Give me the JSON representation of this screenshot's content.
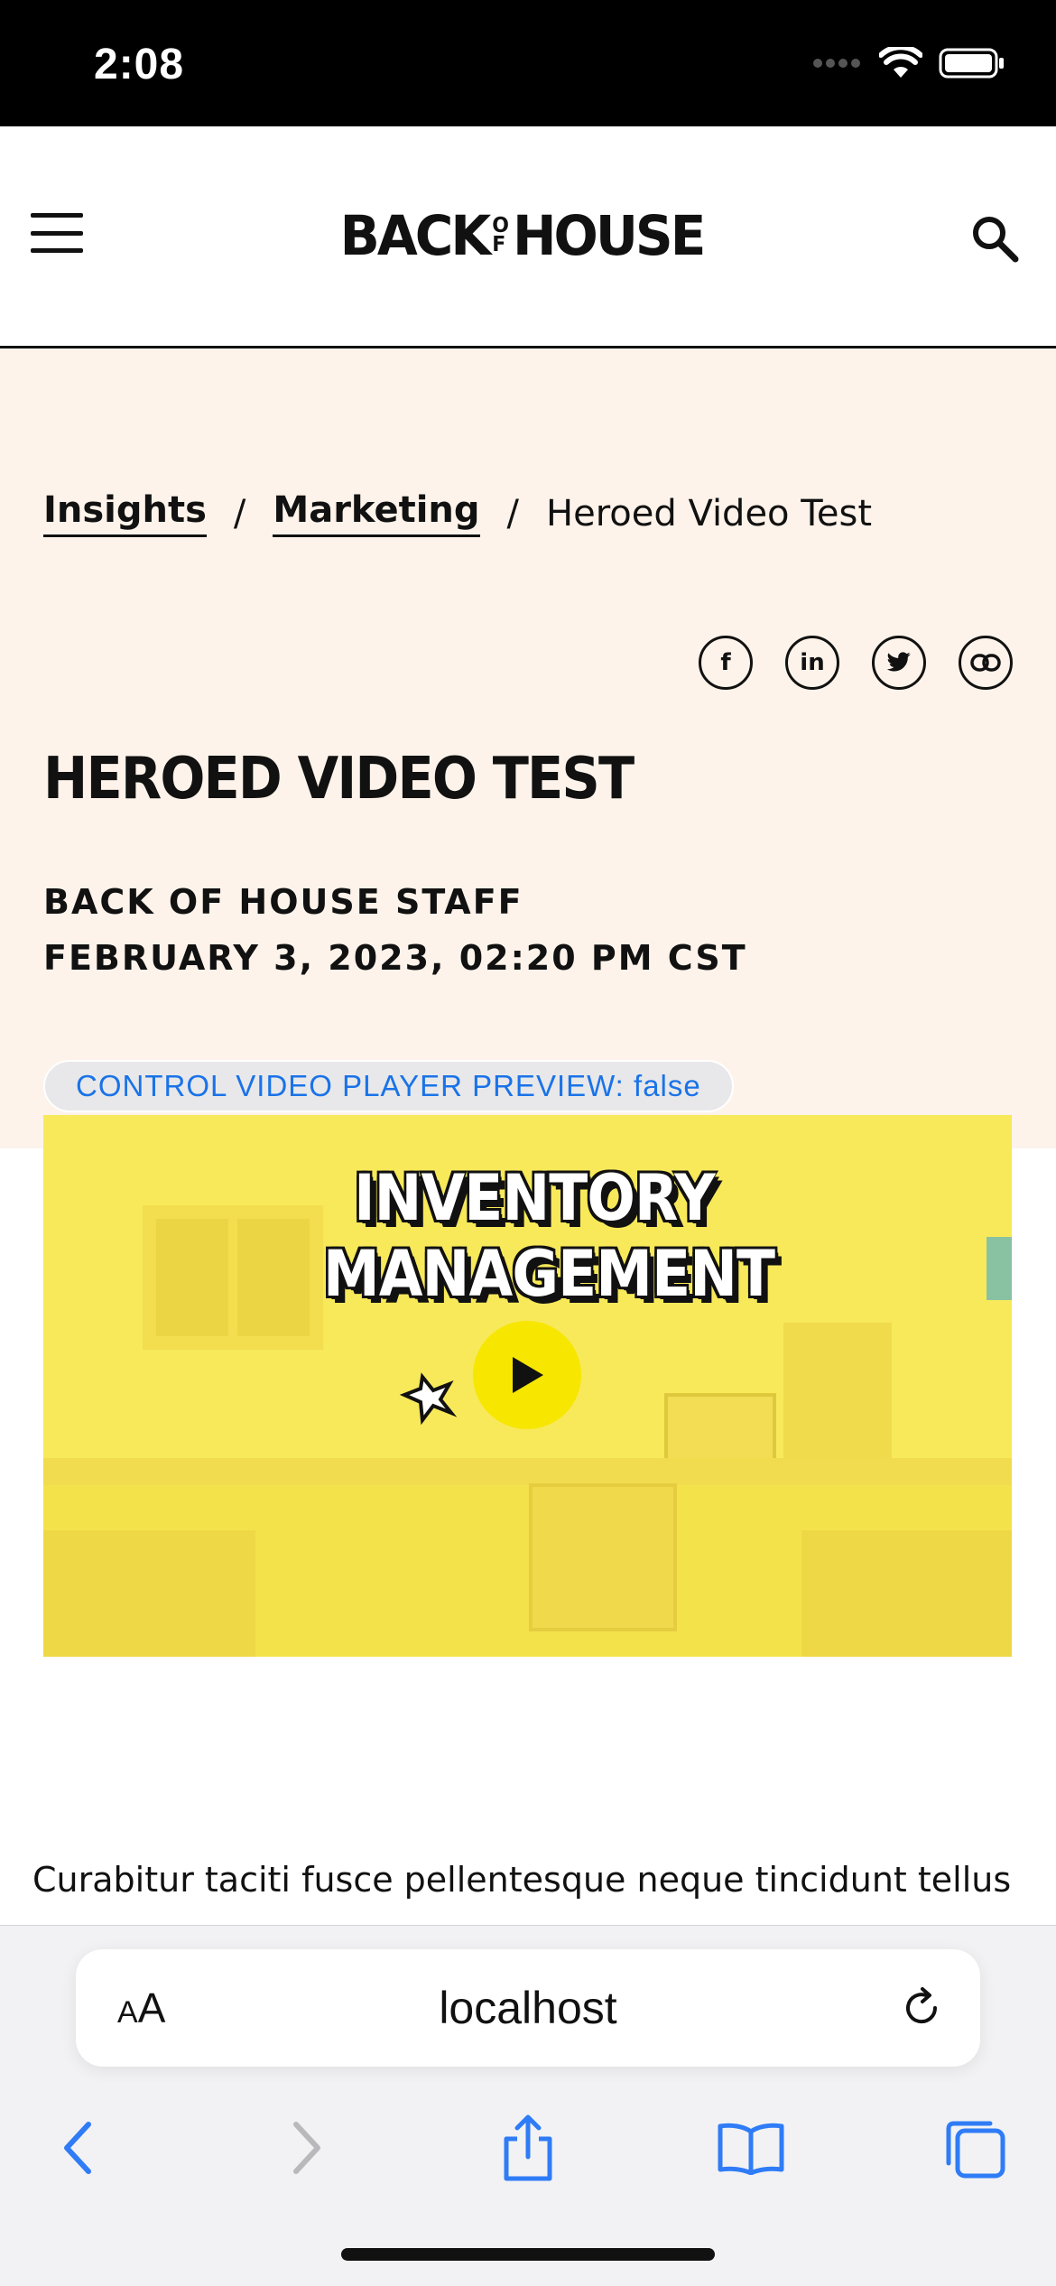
{
  "status_bar": {
    "time": "2:08",
    "icons": [
      "cellular-icon",
      "wifi-icon",
      "battery-icon"
    ]
  },
  "header": {
    "logo_left": "BACK",
    "logo_of_top": "O",
    "logo_of_bottom": "F",
    "logo_right": "HOUSE",
    "menu_icon": "hamburger-menu-icon",
    "search_icon": "search-icon"
  },
  "breadcrumb": {
    "items": [
      {
        "label": "Insights"
      },
      {
        "label": "Marketing"
      }
    ],
    "separator": "/",
    "current": "Heroed Video Test"
  },
  "share": {
    "facebook": "f",
    "linkedin": "in",
    "icons": [
      "facebook-icon",
      "linkedin-icon",
      "twitter-icon",
      "link-icon"
    ]
  },
  "article": {
    "title": "HEROED VIDEO TEST",
    "author": "BACK OF HOUSE STAFF",
    "date": "FEBRUARY 3, 2023, 02:20 PM CST",
    "preview_pill": "CONTROL VIDEO PLAYER PREVIEW: false",
    "video_title_line1": "INVENTORY",
    "video_title_line2": "MANAGEMENT",
    "body_first_line": "Curabitur taciti fusce pellentesque neque tincidunt tellus"
  },
  "browser": {
    "text_size_label_small": "A",
    "text_size_label_large": "A",
    "url": "localhost",
    "toolbar_icons": [
      "back-icon",
      "forward-icon",
      "share-icon",
      "bookmarks-icon",
      "tabs-icon"
    ]
  },
  "colors": {
    "hero_bg": "#fdf3ea",
    "video_bg": "#f7e64d",
    "link_blue": "#1a73e8",
    "ios_blue": "#2f7cf6"
  }
}
